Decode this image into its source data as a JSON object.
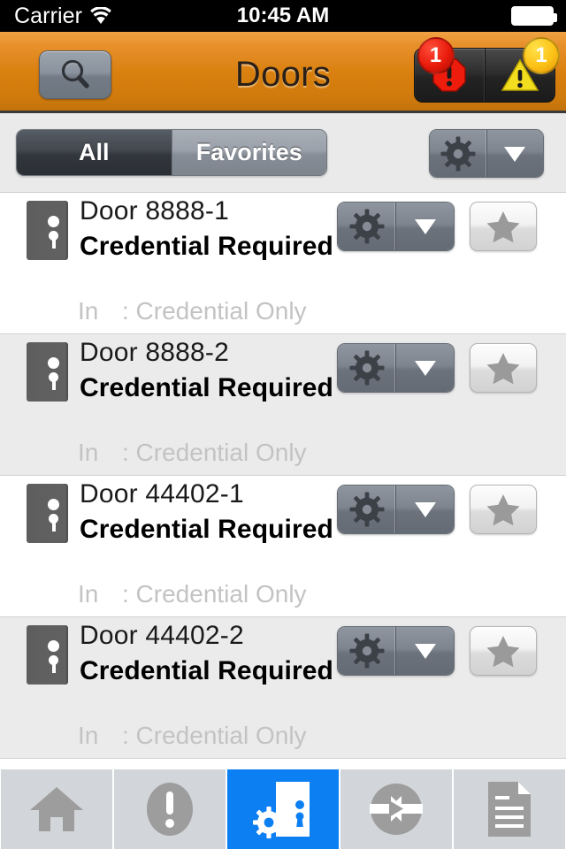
{
  "status_bar": {
    "carrier": "Carrier",
    "wifi_icon": "wifi-icon",
    "time": "10:45 AM",
    "battery_icon": "battery-full-icon"
  },
  "nav_bar": {
    "title": "Doors",
    "search_icon": "search-icon",
    "alerts": [
      {
        "icon": "alarm-octagon-icon",
        "count": "1",
        "color": "#e81b0b"
      },
      {
        "icon": "warning-triangle-icon",
        "count": "1",
        "color": "#fcc216"
      }
    ],
    "accent_color": "#d9800f"
  },
  "toolbar": {
    "segments": [
      {
        "label": "All",
        "selected": true
      },
      {
        "label": "Favorites",
        "selected": false
      }
    ],
    "gear_icon": "gear-icon",
    "dropdown_icon": "chevron-down-icon"
  },
  "list": {
    "rows": [
      {
        "icon": "door-icon",
        "title": "Door 8888-1",
        "status": "Credential Required",
        "sub_direction": "In",
        "sub_mode": ": Credential Only",
        "gear_icon": "gear-icon",
        "dropdown_icon": "chevron-down-icon",
        "favorite_icon": "star-icon"
      },
      {
        "icon": "door-icon",
        "title": "Door 8888-2",
        "status": "Credential Required",
        "sub_direction": "In",
        "sub_mode": ": Credential Only",
        "gear_icon": "gear-icon",
        "dropdown_icon": "chevron-down-icon",
        "favorite_icon": "star-icon"
      },
      {
        "icon": "door-icon",
        "title": "Door 44402-1",
        "status": "Credential Required",
        "sub_direction": "In",
        "sub_mode": ": Credential Only",
        "gear_icon": "gear-icon",
        "dropdown_icon": "chevron-down-icon",
        "favorite_icon": "star-icon"
      },
      {
        "icon": "door-icon",
        "title": "Door 44402-2",
        "status": "Credential Required",
        "sub_direction": "In",
        "sub_mode": ": Credential Only",
        "gear_icon": "gear-icon",
        "dropdown_icon": "chevron-down-icon",
        "favorite_icon": "star-icon"
      }
    ]
  },
  "tab_bar": {
    "active_color": "#0c7ff2",
    "tabs": [
      {
        "icon": "home-icon",
        "active": false
      },
      {
        "icon": "alert-exclamation-icon",
        "active": false
      },
      {
        "icon": "door-settings-icon",
        "active": true
      },
      {
        "icon": "transfer-arrows-icon",
        "active": false
      },
      {
        "icon": "document-icon",
        "active": false
      }
    ]
  }
}
